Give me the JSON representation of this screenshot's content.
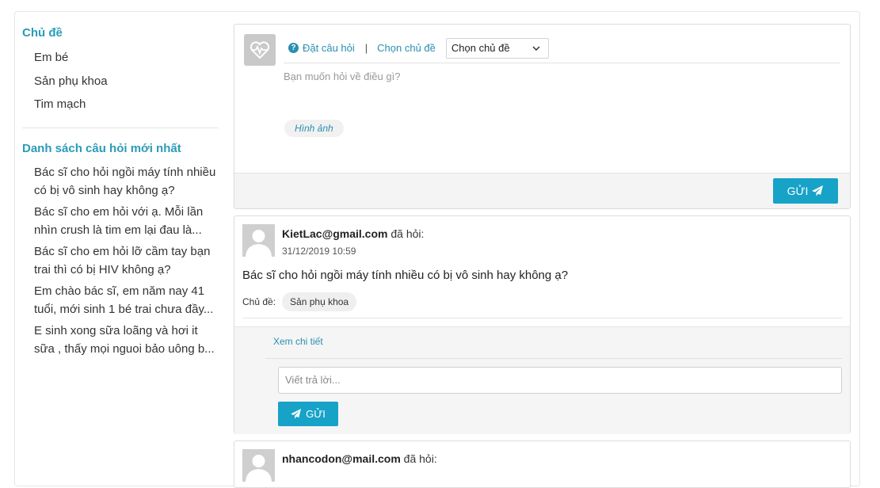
{
  "sidebar": {
    "topics_title": "Chủ đề",
    "topics": [
      "Em bé",
      "Sản phụ khoa",
      "Tim mạch"
    ],
    "latest_title": "Danh sách câu hỏi mới nhất",
    "latest_questions": [
      "Bác sĩ cho hỏi ngồi máy tính nhiều có bị vô sinh hay không ạ?",
      "Bác sĩ cho em hỏi với ạ. Mỗi lần nhìn crush là tim em lại đau là...",
      "Bác sĩ cho em hỏi lỡ cầm tay bạn trai thì có bị HIV không ạ?",
      "Em chào bác sĩ, em năm nay 41 tuổi, mới sinh 1 bé trai chưa đầy...",
      "E sinh xong sữa loãng và hơi it sữa , thấy mọi nguoi bảo uông b..."
    ]
  },
  "ask": {
    "ask_label": "Đặt câu hỏi",
    "separator": "|",
    "choose_topic_label": "Chọn chủ đề",
    "select_value": "Chọn chủ đề",
    "placeholder": "Bạn muốn hỏi về điều gì?",
    "image_button": "Hình ảnh",
    "send_label": "GỬI"
  },
  "questions": [
    {
      "email": "KietLac@gmail.com",
      "asked_suffix": "đã hỏi:",
      "date": "31/12/2019 10:59",
      "text": "Bác sĩ cho hỏi ngồi máy tính nhiều có bị vô sinh hay không ạ?",
      "topic_label": "Chủ đề:",
      "topic": "Sản phụ khoa",
      "detail_link": "Xem chi tiết",
      "reply_placeholder": "Viết trả lời...",
      "reply_button": "GỬI"
    },
    {
      "email": "nhancodon@mail.com",
      "asked_suffix": "đã hỏi:"
    }
  ],
  "colors": {
    "accent": "#17a2c7",
    "link": "#2a8fb0",
    "heading": "#2a9bb8"
  },
  "icons": {
    "ask_avatar": "heart-pulse-icon",
    "help": "question-circle-icon",
    "send": "paper-plane-icon",
    "dropdown": "chevron-down-icon",
    "user": "user-silhouette-icon"
  }
}
